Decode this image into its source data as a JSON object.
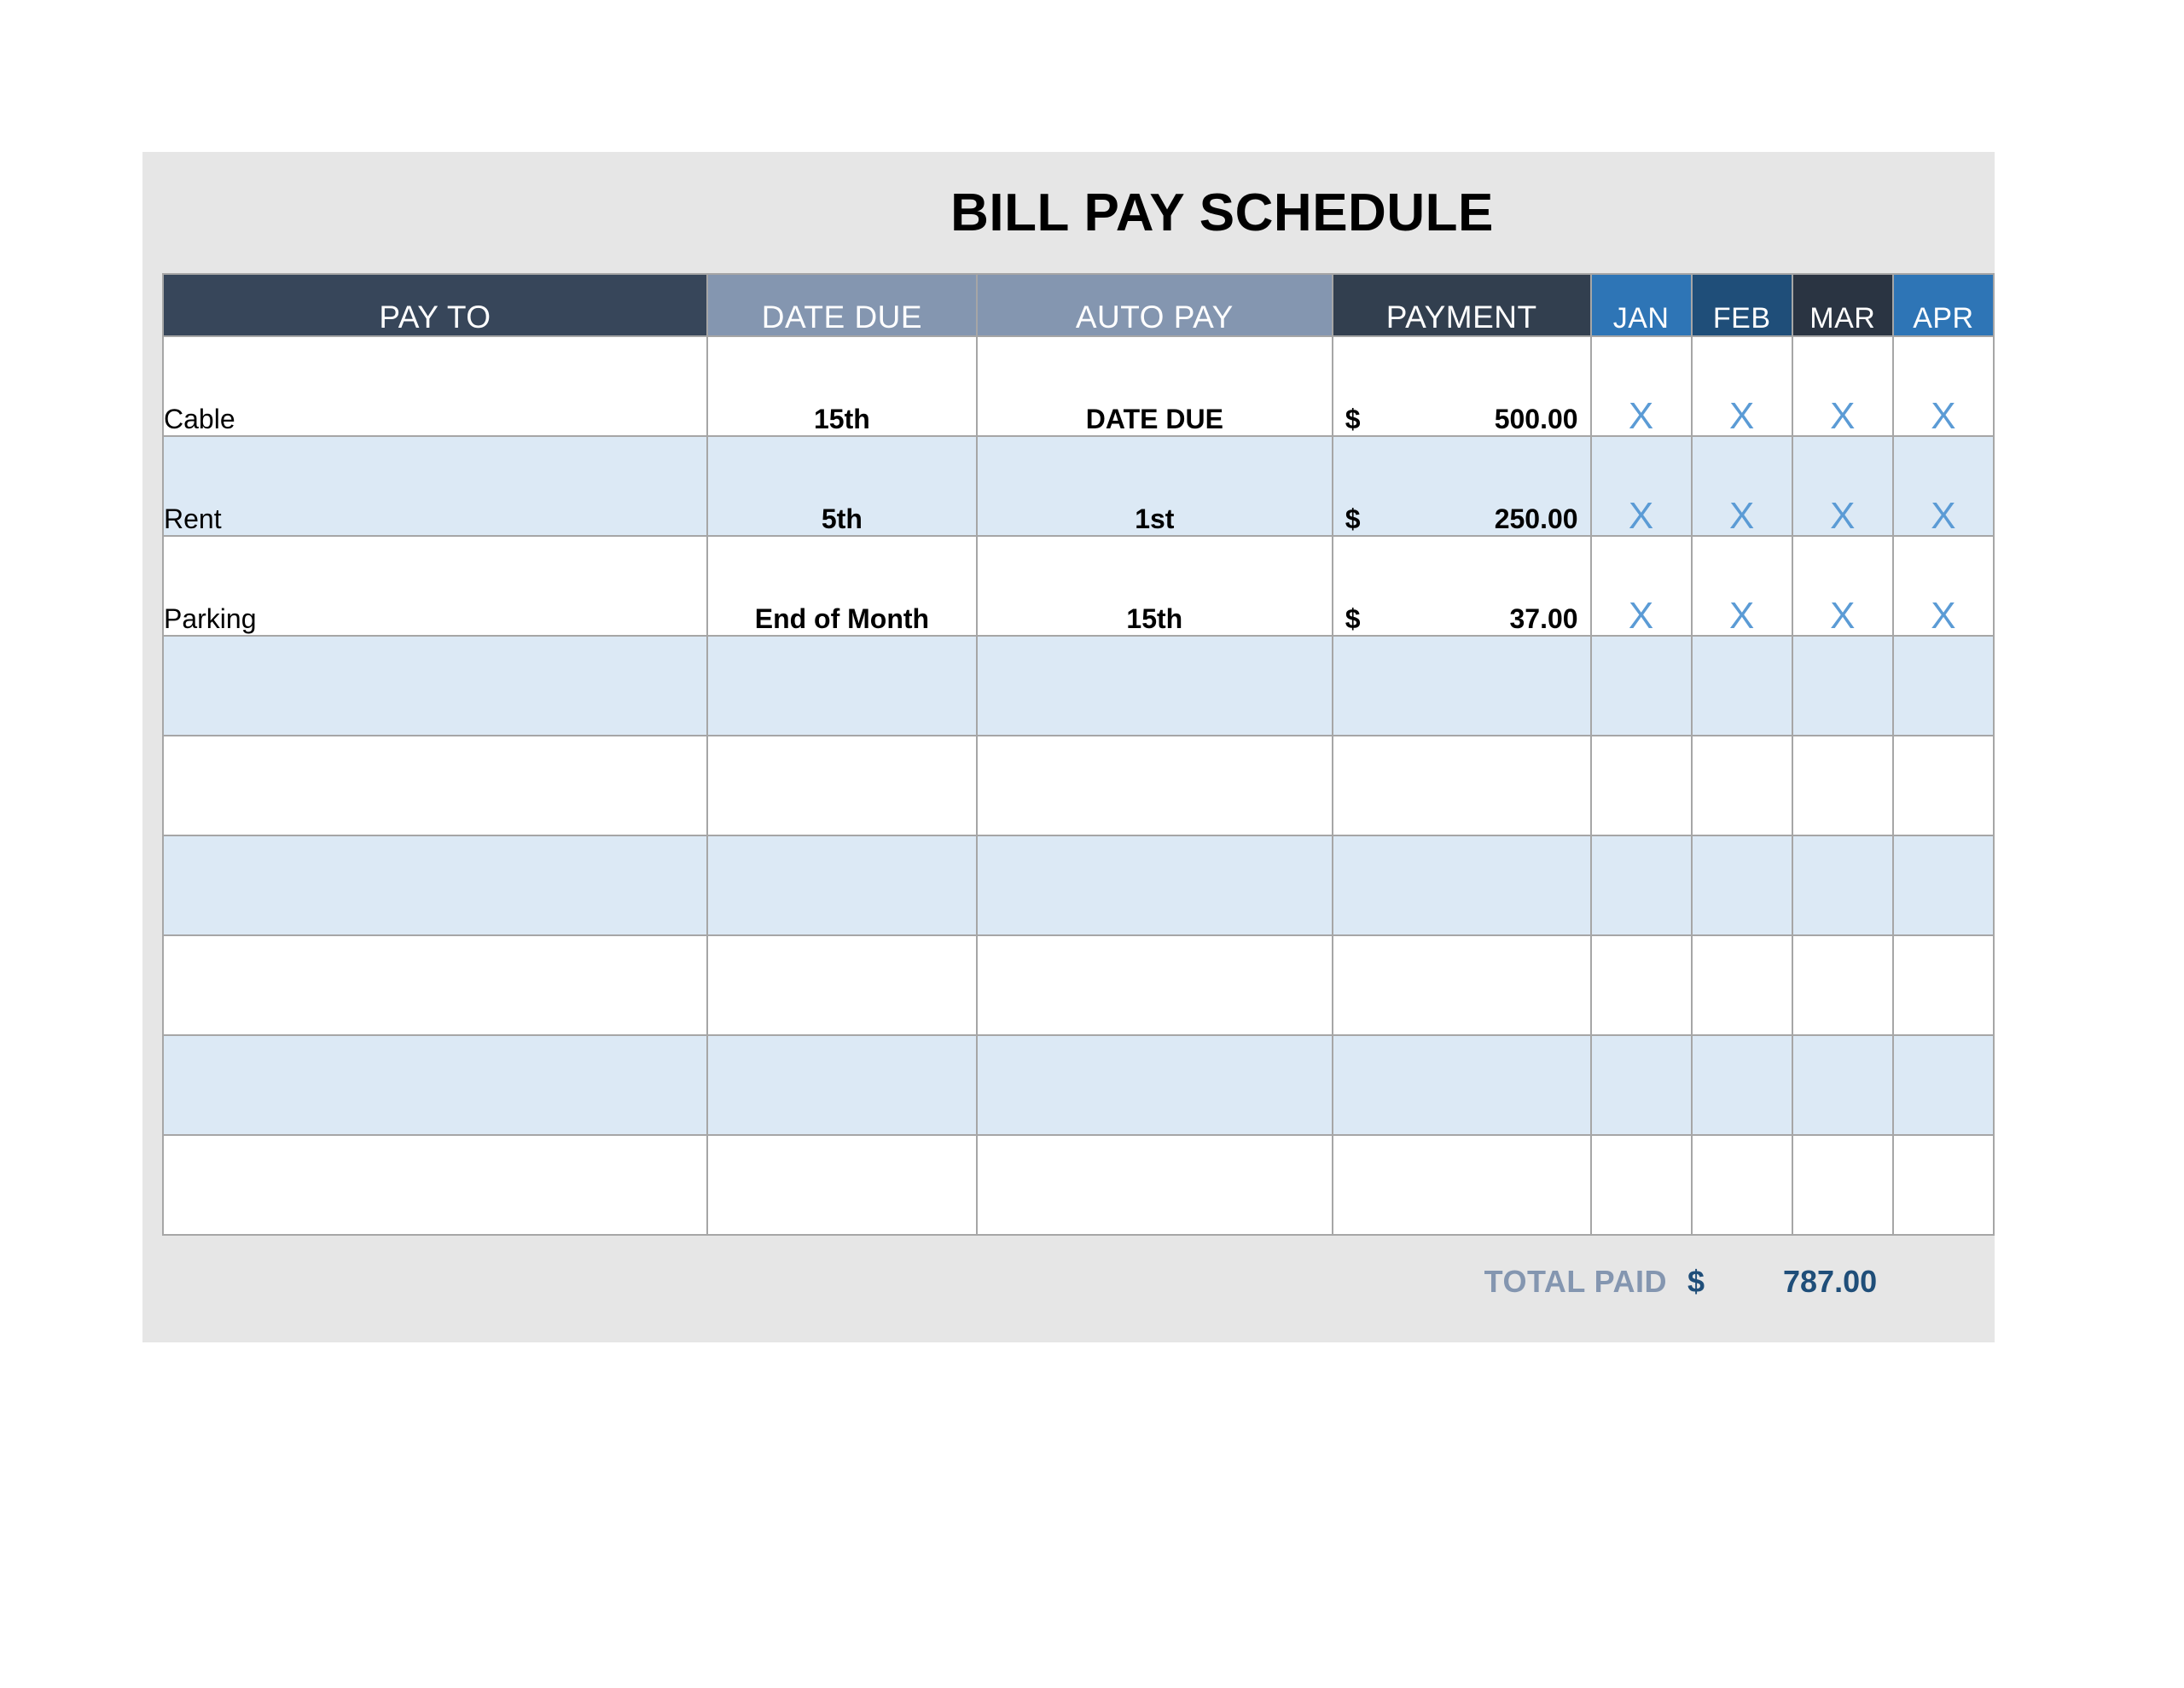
{
  "document": {
    "title": "BILL PAY SCHEDULE"
  },
  "table": {
    "headers": {
      "pay_to": "PAY TO",
      "date_due": "DATE DUE",
      "auto_pay": "AUTO PAY",
      "payment": "PAYMENT",
      "months": [
        "JAN",
        "FEB",
        "MAR",
        "APR"
      ]
    },
    "rows": [
      {
        "pay_to": "Cable",
        "date_due": "15th",
        "auto_pay": "DATE DUE",
        "payment_symbol": "$",
        "payment_amount": "500.00",
        "months": [
          "X",
          "X",
          "X",
          "X"
        ]
      },
      {
        "pay_to": "Rent",
        "date_due": "5th",
        "auto_pay": "1st",
        "payment_symbol": "$",
        "payment_amount": "250.00",
        "months": [
          "X",
          "X",
          "X",
          "X"
        ]
      },
      {
        "pay_to": "Parking",
        "date_due": "End of Month",
        "auto_pay": "15th",
        "payment_symbol": "$",
        "payment_amount": "37.00",
        "months": [
          "X",
          "X",
          "X",
          "X"
        ]
      },
      {
        "pay_to": "",
        "date_due": "",
        "auto_pay": "",
        "payment_symbol": "",
        "payment_amount": "",
        "months": [
          "",
          "",
          "",
          ""
        ]
      },
      {
        "pay_to": "",
        "date_due": "",
        "auto_pay": "",
        "payment_symbol": "",
        "payment_amount": "",
        "months": [
          "",
          "",
          "",
          ""
        ]
      },
      {
        "pay_to": "",
        "date_due": "",
        "auto_pay": "",
        "payment_symbol": "",
        "payment_amount": "",
        "months": [
          "",
          "",
          "",
          ""
        ]
      },
      {
        "pay_to": "",
        "date_due": "",
        "auto_pay": "",
        "payment_symbol": "",
        "payment_amount": "",
        "months": [
          "",
          "",
          "",
          ""
        ]
      },
      {
        "pay_to": "",
        "date_due": "",
        "auto_pay": "",
        "payment_symbol": "",
        "payment_amount": "",
        "months": [
          "",
          "",
          "",
          ""
        ]
      },
      {
        "pay_to": "",
        "date_due": "",
        "auto_pay": "",
        "payment_symbol": "",
        "payment_amount": "",
        "months": [
          "",
          "",
          "",
          ""
        ]
      }
    ]
  },
  "total": {
    "label": "TOTAL PAID",
    "symbol": "$",
    "amount": "787.00"
  },
  "colors": {
    "panel_background": "#e6e6e6",
    "header_payto": "#37465a",
    "header_datedue": "#8496b0",
    "header_payment": "#323f4f",
    "header_jan": "#2e75b6",
    "header_feb": "#1f4e79",
    "header_mar": "#2a3442",
    "header_apr": "#2e75b6",
    "row_alt": "#dce9f5",
    "mark_x": "#5b9bd5",
    "total_label": "#8496b0",
    "total_value": "#1f4e79",
    "grid_line": "#a6a6a6"
  }
}
